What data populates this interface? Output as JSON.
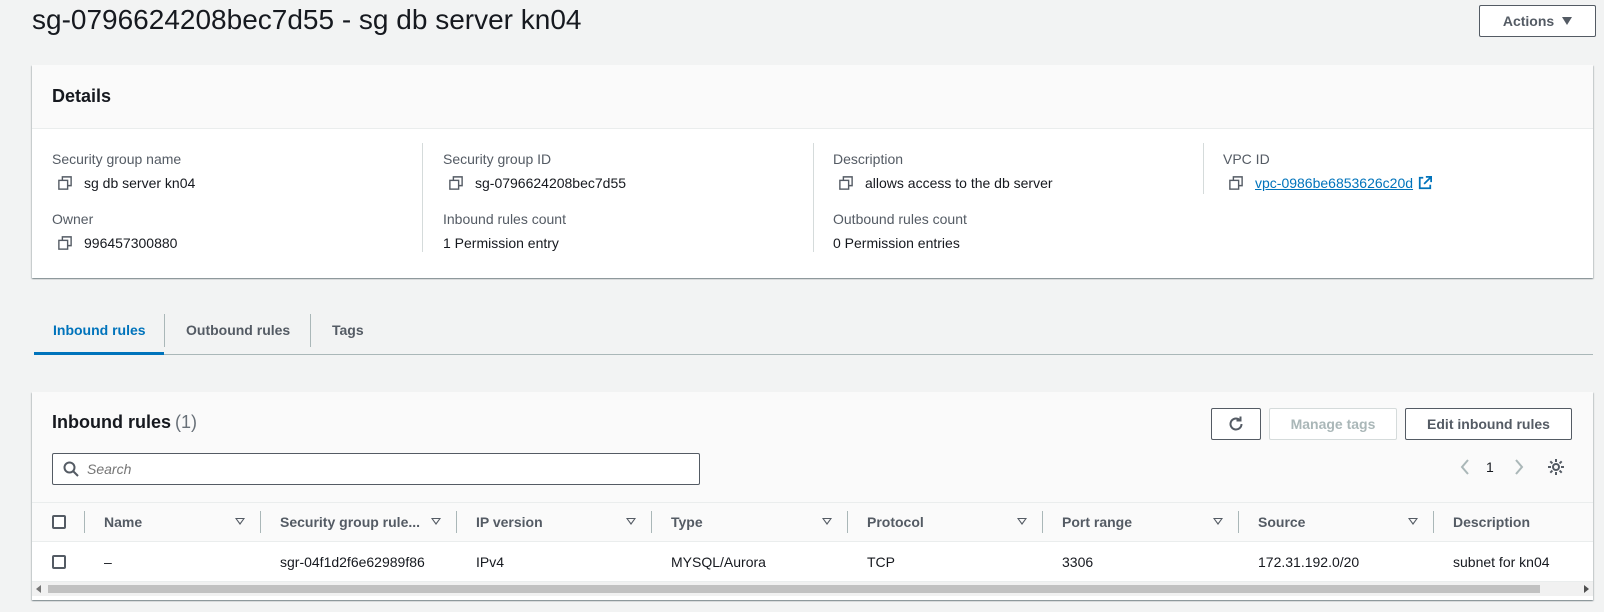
{
  "page": {
    "title": "sg-0796624208bec7d55 - sg db server kn04",
    "actions_label": "Actions"
  },
  "details": {
    "title": "Details",
    "fields": {
      "sg_name": {
        "label": "Security group name",
        "value": "sg db server kn04"
      },
      "sg_id": {
        "label": "Security group ID",
        "value": "sg-0796624208bec7d55"
      },
      "description": {
        "label": "Description",
        "value": "allows access to the db server"
      },
      "vpc_id": {
        "label": "VPC ID",
        "value": "vpc-0986be6853626c20d"
      },
      "owner": {
        "label": "Owner",
        "value": "996457300880"
      },
      "inbound_count": {
        "label": "Inbound rules count",
        "value": "1 Permission entry"
      },
      "outbound_count": {
        "label": "Outbound rules count",
        "value": "0 Permission entries"
      }
    }
  },
  "tabs": [
    {
      "label": "Inbound rules",
      "active": true
    },
    {
      "label": "Outbound rules",
      "active": false
    },
    {
      "label": "Tags",
      "active": false
    }
  ],
  "inbound": {
    "title": "Inbound rules",
    "count": "(1)",
    "refresh_icon": "refresh-icon",
    "manage_tags_label": "Manage tags",
    "edit_label": "Edit inbound rules",
    "search_placeholder": "Search",
    "page_number": "1",
    "columns": [
      "Name",
      "Security group rule...",
      "IP version",
      "Type",
      "Protocol",
      "Port range",
      "Source",
      "Description"
    ],
    "rows": [
      {
        "name": "–",
        "rule_id": "sgr-04f1d2f6e62989f86",
        "ip_version": "IPv4",
        "type": "MYSQL/Aurora",
        "protocol": "TCP",
        "port_range": "3306",
        "source": "172.31.192.0/20",
        "description": "subnet for kn04"
      }
    ]
  },
  "colors": {
    "link": "#0073bb",
    "text": "#16191f",
    "muted": "#545b64"
  }
}
